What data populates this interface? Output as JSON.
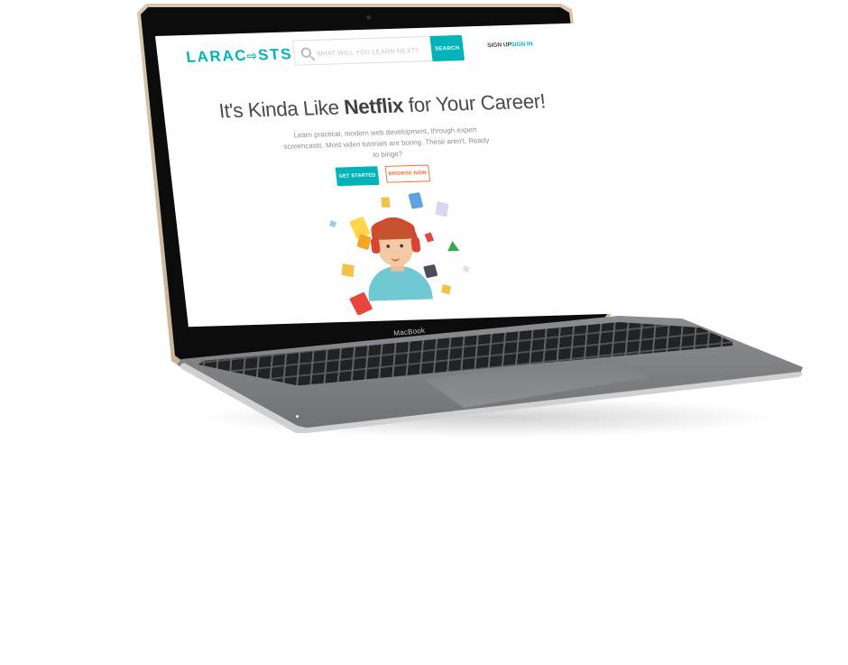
{
  "device": {
    "label": "MacBook"
  },
  "site": {
    "logo": "LARACASTS",
    "logo_left": "LARAC",
    "logo_right": "STS",
    "search": {
      "placeholder": "WHAT WILL YOU LEARN NEXT?",
      "button": "SEARCH",
      "icon": "search-icon"
    },
    "nav": {
      "signup": "SIGN UP",
      "signin": "SIGN IN"
    },
    "hero": {
      "title_pre": "It's Kinda Like ",
      "title_bold": "Netflix",
      "title_post": " for Your Career!",
      "subtitle": "Learn practical, modern web development, through expert screencasts. Most video tutorials are boring. These aren't. Ready to binge?",
      "cta_primary": "GET STARTED",
      "cta_secondary": "BROWSE NOW"
    },
    "colors": {
      "brand": "#00b3b9",
      "accent": "#f26a2e",
      "heading": "#474b52"
    }
  }
}
